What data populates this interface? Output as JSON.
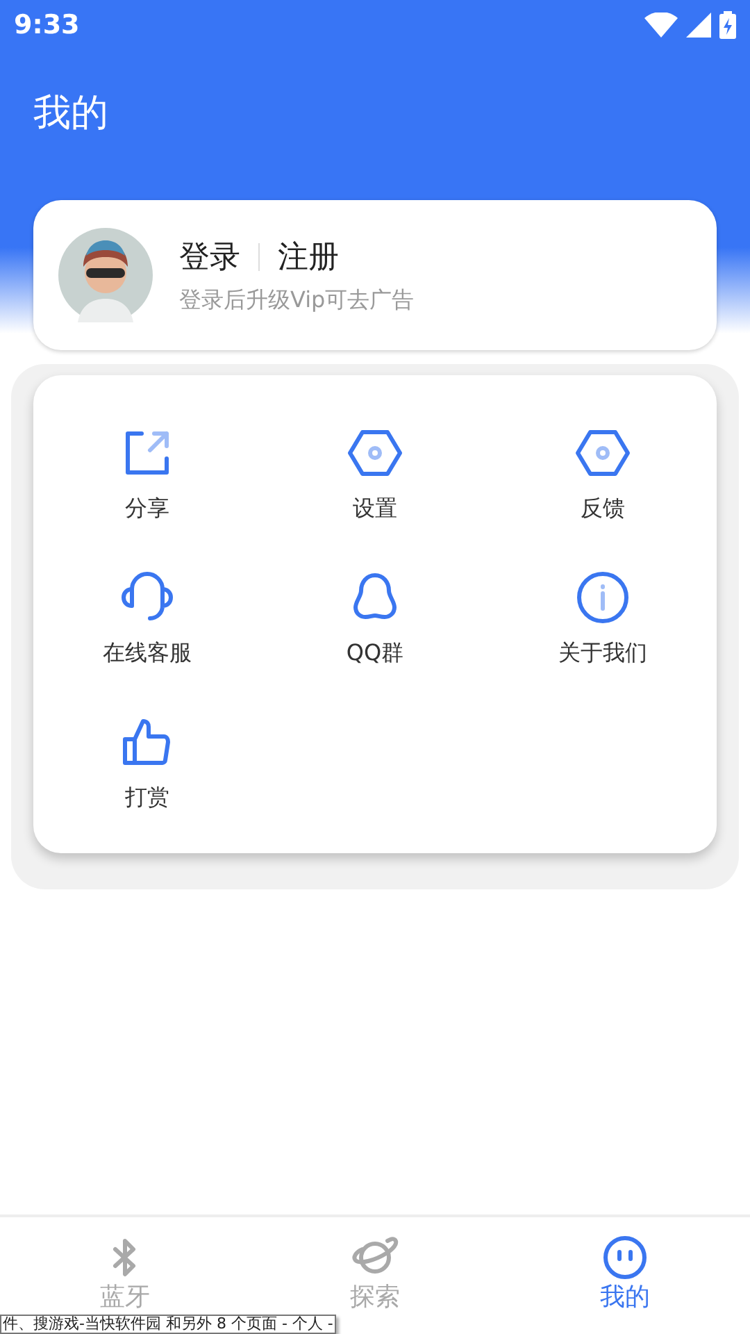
{
  "status_bar": {
    "time": "9:33"
  },
  "header": {
    "title": "我的"
  },
  "profile": {
    "login": "登录",
    "register": "注册",
    "subtitle": "登录后升级Vip可去广告"
  },
  "menu": [
    {
      "kind": "share",
      "label": "分享"
    },
    {
      "kind": "settings",
      "label": "设置"
    },
    {
      "kind": "feedback",
      "label": "反馈"
    },
    {
      "kind": "support",
      "label": "在线客服"
    },
    {
      "kind": "qq",
      "label": "QQ群"
    },
    {
      "kind": "about",
      "label": "关于我们"
    },
    {
      "kind": "reward",
      "label": "打赏"
    }
  ],
  "tabs": [
    {
      "kind": "bluetooth",
      "label": "蓝牙",
      "selected": false
    },
    {
      "kind": "explore",
      "label": "探索",
      "selected": false
    },
    {
      "kind": "me",
      "label": "我的",
      "selected": true
    }
  ],
  "tooltip": "件、搜游戏-当快软件园 和另外 8 个页面 - 个人 -"
}
